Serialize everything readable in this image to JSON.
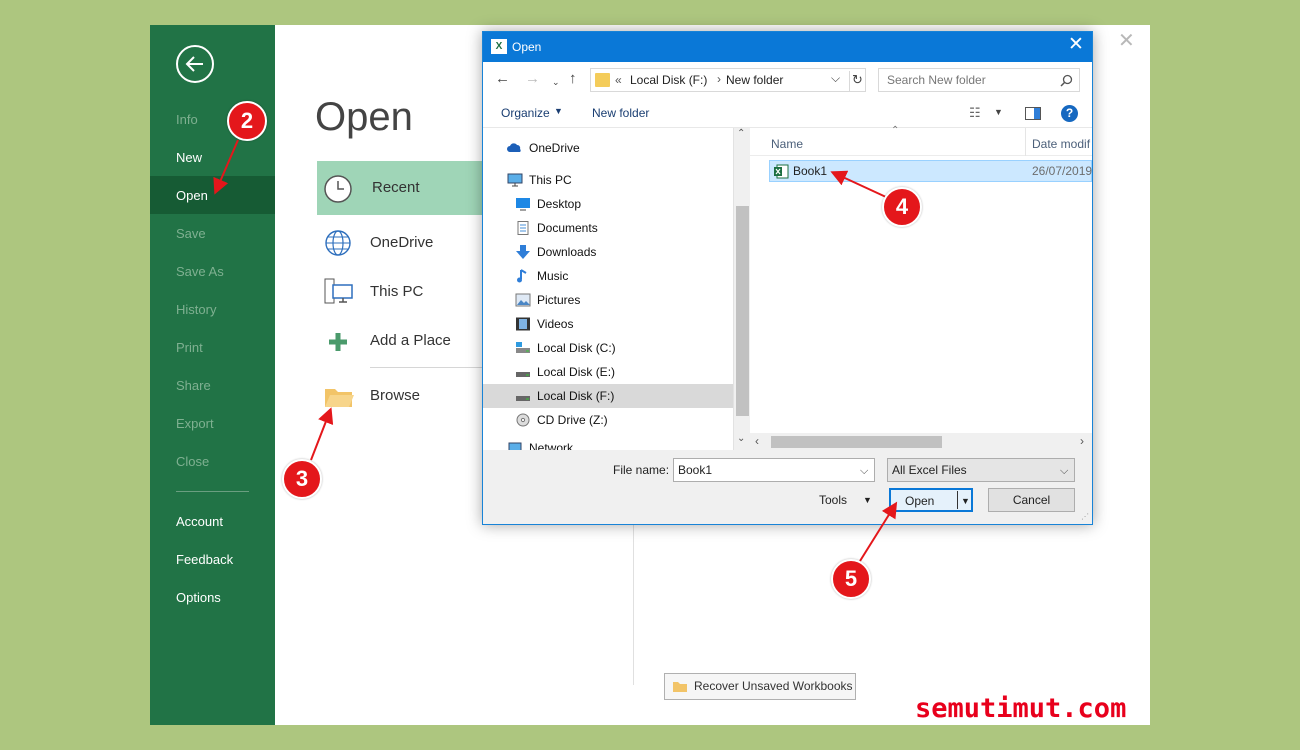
{
  "backstage": {
    "sidebar": {
      "items": [
        {
          "label": "Info",
          "enabled": false
        },
        {
          "label": "New",
          "enabled": true
        },
        {
          "label": "Open",
          "enabled": true,
          "selected": true
        },
        {
          "label": "Save",
          "enabled": false
        },
        {
          "label": "Save As",
          "enabled": false
        },
        {
          "label": "History",
          "enabled": false
        },
        {
          "label": "Print",
          "enabled": false
        },
        {
          "label": "Share",
          "enabled": false
        },
        {
          "label": "Export",
          "enabled": false
        },
        {
          "label": "Close",
          "enabled": false
        }
      ],
      "footer": [
        {
          "label": "Account"
        },
        {
          "label": "Feedback"
        },
        {
          "label": "Options"
        }
      ]
    },
    "title": "Open",
    "locations": [
      {
        "label": "Recent",
        "icon": "clock-icon",
        "selected": true
      },
      {
        "label": "OneDrive",
        "icon": "globe-icon"
      },
      {
        "label": "This PC",
        "icon": "computer-icon"
      },
      {
        "label": "Add a Place",
        "icon": "plus-icon"
      },
      {
        "label": "Browse",
        "icon": "folder-icon"
      }
    ],
    "recover_label": "Recover Unsaved Workbooks",
    "close_glyph": "✕"
  },
  "dialog": {
    "title": "Open",
    "app_badge": "X",
    "address": {
      "prefix": "«",
      "segments": [
        "Local Disk (F:)",
        "New folder"
      ],
      "separator": "›"
    },
    "search_placeholder": "Search New folder",
    "toolbar": {
      "organize": "Organize",
      "new_folder": "New folder",
      "help": "?"
    },
    "nav_items": [
      {
        "label": "OneDrive",
        "icon": "cloud-icon",
        "level": 0
      },
      {
        "label": "This PC",
        "icon": "monitor-icon",
        "level": 0
      },
      {
        "label": "Desktop",
        "icon": "desktop-icon",
        "level": 1
      },
      {
        "label": "Documents",
        "icon": "documents-icon",
        "level": 1
      },
      {
        "label": "Downloads",
        "icon": "download-icon",
        "level": 1
      },
      {
        "label": "Music",
        "icon": "music-icon",
        "level": 1
      },
      {
        "label": "Pictures",
        "icon": "pictures-icon",
        "level": 1
      },
      {
        "label": "Videos",
        "icon": "videos-icon",
        "level": 1
      },
      {
        "label": "Local Disk (C:)",
        "icon": "drive-icon",
        "level": 1
      },
      {
        "label": "Local Disk (E:)",
        "icon": "drive-icon",
        "level": 1
      },
      {
        "label": "Local Disk (F:)",
        "icon": "drive-icon",
        "level": 1,
        "selected": true
      },
      {
        "label": "CD Drive (Z:)",
        "icon": "cd-icon",
        "level": 1
      },
      {
        "label": "Network",
        "icon": "network-icon",
        "level": 0
      }
    ],
    "columns": {
      "name": "Name",
      "date": "Date modif"
    },
    "files": [
      {
        "name": "Book1",
        "date": "26/07/2019",
        "icon": "excel-file-icon",
        "selected": true
      }
    ],
    "file_name_label": "File name:",
    "file_name_value": "Book1",
    "file_type": "All Excel Files",
    "tools_label": "Tools",
    "open_label": "Open",
    "cancel_label": "Cancel"
  },
  "callouts": [
    "2",
    "3",
    "4",
    "5"
  ],
  "watermark": "semutimut.com",
  "colors": {
    "excel_green": "#217346",
    "excel_green_dark": "#165b34",
    "recent_highlight": "#9fd5b7",
    "dialog_blue": "#0a78d7",
    "callout_red": "#e4171b",
    "page_bg": "#adc67f"
  }
}
